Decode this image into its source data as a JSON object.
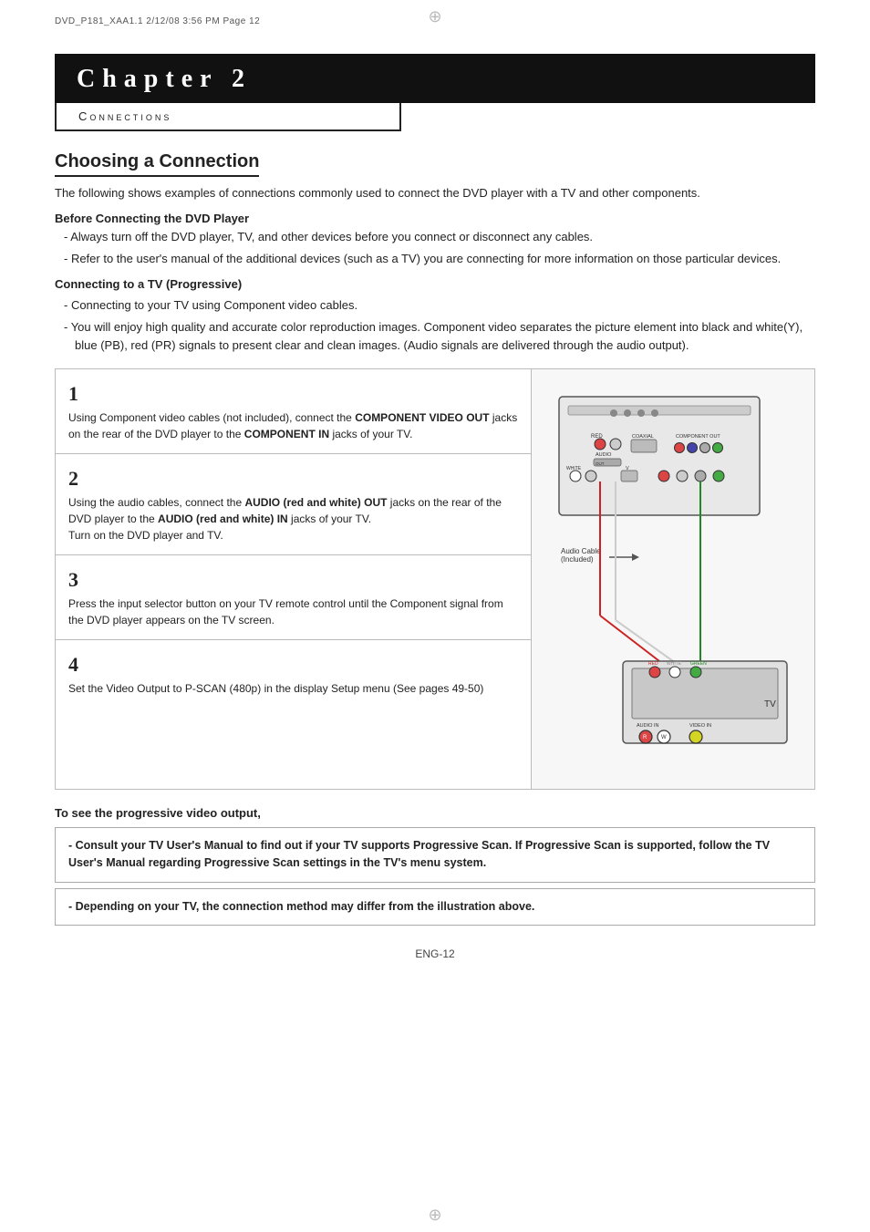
{
  "header": {
    "meta": "DVD_P181_XAA1.1   2/12/08   3:56 PM   Page 12"
  },
  "chapter": {
    "label": "Chapter 2",
    "subtitle": "Connections"
  },
  "section1": {
    "title": "Choosing a Connection",
    "intro": "The following shows examples of connections commonly used to connect the DVD player with a TV and other components.",
    "before_heading": "Before Connecting the DVD Player",
    "bullet1": "-  Always turn off the DVD player, TV, and other devices before you connect or disconnect any cables.",
    "bullet2": "-  Refer to the user's manual of the additional devices (such as a TV) you are connecting for more information on those particular devices.",
    "tv_heading": "Connecting to a TV (Progressive)",
    "tv_bullet1": "-  Connecting to your TV using Component video cables.",
    "tv_bullet2": "-  You will enjoy high quality and accurate color reproduction images. Component video separates the picture element into black and white(Y), blue (PB), red (PR) signals to present clear and clean images. (Audio signals are delivered through the audio output)."
  },
  "steps": [
    {
      "num": "1",
      "text": "Using Component video cables (not included), connect the COMPONENT VIDEO OUT jacks on the rear of the DVD player to the COMPONENT IN jacks of your TV."
    },
    {
      "num": "2",
      "text": "Using the audio cables, connect the AUDIO (red and white) OUT jacks on the rear of the DVD player to the AUDIO (red and white) IN jacks of your TV.\nTurn on the DVD player and TV."
    },
    {
      "num": "3",
      "text": "Press the input selector button on your TV remote control until the Component signal from the DVD player appears on the TV screen."
    },
    {
      "num": "4",
      "text": "Set the Video Output to P-SCAN (480p)  in the display Setup menu (See pages 49-50)"
    }
  ],
  "progressive_note": {
    "heading": "To see the progressive video output,",
    "note1": "- Consult your TV User's Manual to find out if your TV supports Progressive Scan. If Progressive Scan is supported, follow the TV User's Manual regarding Progressive Scan settings in the TV's menu system.",
    "note2": "- Depending on your TV, the connection method may differ from the illustration above."
  },
  "page_num": "ENG-12"
}
